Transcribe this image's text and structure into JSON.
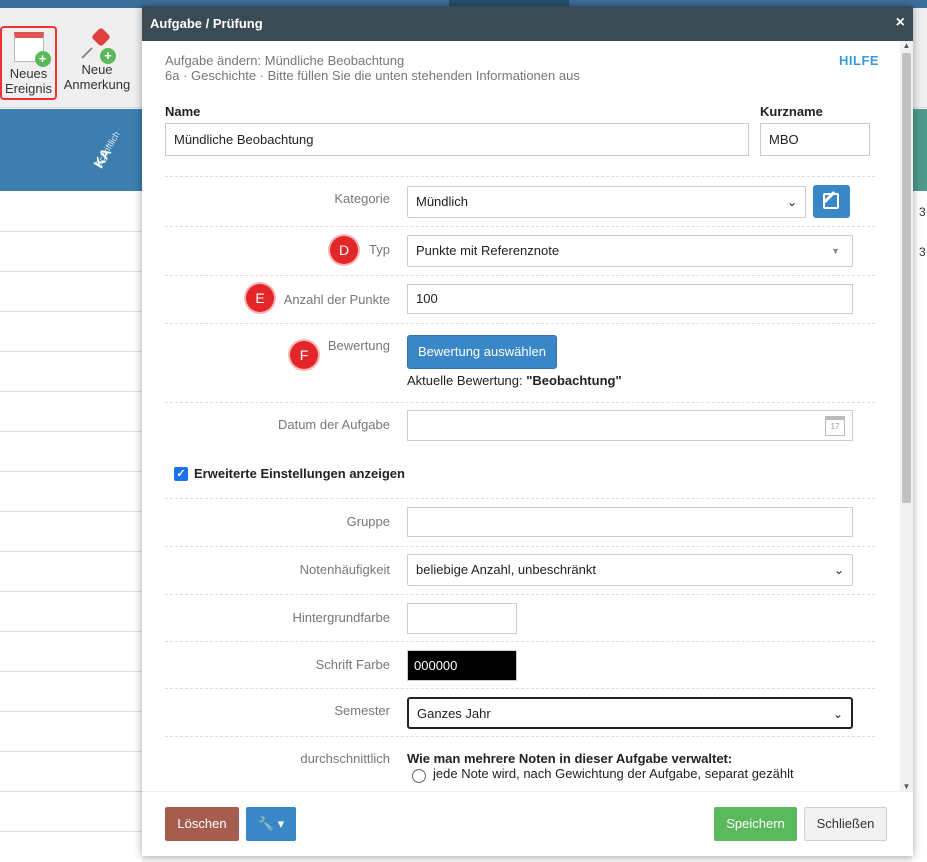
{
  "toolbar": {
    "new_event": {
      "line1": "Neues",
      "line2": "Ereignis"
    },
    "new_note": {
      "line1": "Neue",
      "line2": "Anmerkung"
    }
  },
  "background": {
    "column_small": "Schriftlich",
    "column_label": "KA",
    "right_values": [
      "3",
      "3"
    ]
  },
  "modal": {
    "title": "Aufgabe / Prüfung",
    "close": "×",
    "subtitle1": "Aufgabe ändern: Mündliche Beobachtung",
    "subtitle2": "6a · Geschichte · Bitte füllen Sie die unten stehenden Informationen aus",
    "help": "HILFE",
    "name_label": "Name",
    "name_value": "Mündliche Beobachtung",
    "shortname_label": "Kurzname",
    "shortname_value": "MBO",
    "fields": {
      "kategorie": {
        "label": "Kategorie",
        "value": "Mündlich"
      },
      "typ": {
        "label": "Typ",
        "value": "Punkte mit Referenznote",
        "badge": "D"
      },
      "punkte": {
        "label": "Anzahl der Punkte",
        "value": "100",
        "badge": "E"
      },
      "bewertung": {
        "label": "Bewertung",
        "button": "Bewertung auswählen",
        "current_prefix": "Aktuelle Bewertung: ",
        "current_value": "\"Beobachtung\"",
        "badge": "F"
      },
      "datum": {
        "label": "Datum der Aufgabe",
        "value": "",
        "cal_day": "17"
      },
      "erweitert": {
        "label": "Erweiterte Einstellungen anzeigen",
        "checked": true
      },
      "gruppe": {
        "label": "Gruppe",
        "value": ""
      },
      "haeufigkeit": {
        "label": "Notenhäufigkeit",
        "value": "beliebige Anzahl, unbeschränkt"
      },
      "hintergrund": {
        "label": "Hintergrundfarbe",
        "value": "",
        "color": "#ffffff"
      },
      "schrift": {
        "label": "Schrift Farbe",
        "value": "000000",
        "color": "#000000"
      },
      "semester": {
        "label": "Semester",
        "value": "Ganzes Jahr"
      },
      "durchschnitt": {
        "label": "durchschnittlich",
        "question": "Wie man mehrere Noten in dieser Aufgabe verwaltet:",
        "option1": "jede Note wird, nach Gewichtung der Aufgabe, separat gezählt"
      }
    },
    "footer": {
      "delete": "Löschen",
      "tools": "▾",
      "save": "Speichern",
      "close": "Schließen"
    }
  }
}
